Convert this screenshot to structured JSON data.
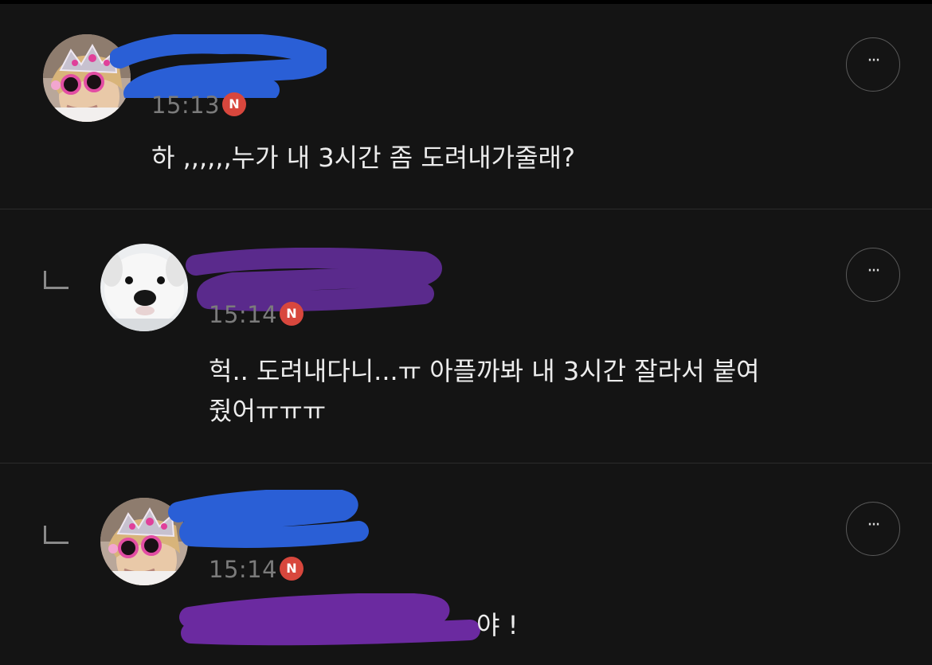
{
  "comments": [
    {
      "time": "15:13",
      "badge": "N",
      "text": "하 ,,,,,,누가 내 3시간 좀 도려내가줄래?",
      "more_label": "···",
      "avatar": "princess-avatar-icon",
      "name_redaction_color": "#2a5fd6"
    },
    {
      "time": "15:14",
      "badge": "N",
      "text": "헉.. 도려내다니...ㅠ 아플까봐 내 3시간 잘라서 붙여\n줬어ㅠㅠㅠ",
      "more_label": "···",
      "avatar": "puppy-avatar-icon",
      "name_redaction_color": "#5a2a8c",
      "is_reply": true
    },
    {
      "time": "15:14",
      "badge": "N",
      "text": "야 !",
      "more_label": "···",
      "avatar": "princess-avatar-icon",
      "name_redaction_color": "#2a5fd6",
      "text_redaction_color": "#6b2aa0",
      "is_reply": true
    }
  ]
}
